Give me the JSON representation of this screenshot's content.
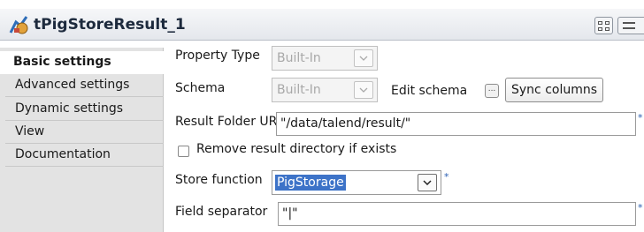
{
  "header": {
    "title": "tPigStoreResult_1",
    "icon": "pig-component-icon",
    "view_buttons": [
      "grid-view-icon",
      "list-view-icon"
    ]
  },
  "sidebar": {
    "tabs": [
      {
        "label": "Basic settings",
        "active": true
      },
      {
        "label": "Advanced settings",
        "active": false
      },
      {
        "label": "Dynamic settings",
        "active": false
      },
      {
        "label": "View",
        "active": false
      },
      {
        "label": "Documentation",
        "active": false
      }
    ]
  },
  "form": {
    "property_type": {
      "label": "Property Type",
      "value": "Built-In"
    },
    "schema": {
      "label": "Schema",
      "value": "Built-In",
      "edit_label": "Edit schema",
      "edit_button": "...",
      "sync_label": "Sync columns"
    },
    "result_folder": {
      "label": "Result Folder URI",
      "value": "\"/data/talend/result/\""
    },
    "remove_dir": {
      "label": "Remove result directory if exists",
      "checked": false
    },
    "store_function": {
      "label": "Store function",
      "value": "PigStorage"
    },
    "field_separator": {
      "label": "Field separator",
      "value": "\"|\""
    },
    "required_marker": "*"
  }
}
